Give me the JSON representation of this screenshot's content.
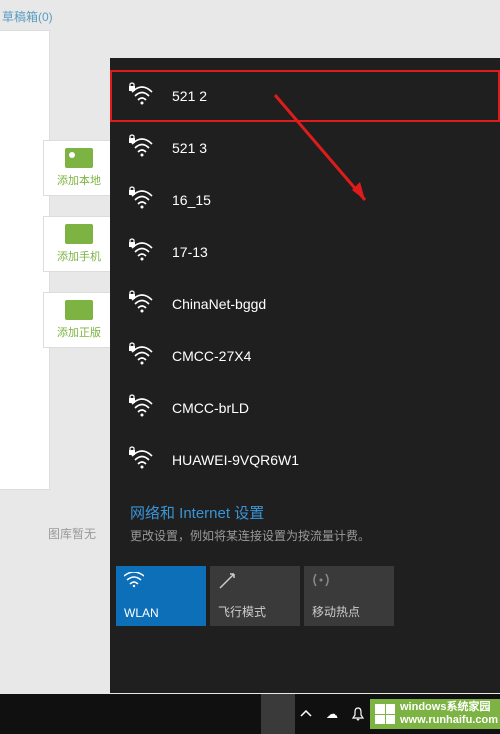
{
  "top": {
    "draft_label": "草稿箱(0)"
  },
  "side": {
    "add_local": "添加本地",
    "add_phone": "添加手机",
    "add_genuine": "添加正版"
  },
  "gallery": {
    "empty": "图库暂无"
  },
  "wifi": {
    "networks": [
      {
        "ssid": "521 2",
        "secured": true,
        "highlighted": true
      },
      {
        "ssid": "521 3",
        "secured": true
      },
      {
        "ssid": "16_15",
        "secured": true
      },
      {
        "ssid": "17-13",
        "secured": true
      },
      {
        "ssid": "ChinaNet-bggd",
        "secured": true
      },
      {
        "ssid": "CMCC-27X4",
        "secured": true
      },
      {
        "ssid": "CMCC-brLD",
        "secured": true
      },
      {
        "ssid": "HUAWEI-9VQR6W1",
        "secured": true
      }
    ],
    "settings_title": "网络和 Internet 设置",
    "settings_sub": "更改设置，例如将某连接设置为按流量计费。",
    "tiles": {
      "wlan": "WLAN",
      "airplane": "飞行模式",
      "hotspot": "移动热点"
    }
  },
  "watermark": {
    "line1": "windows系统家园",
    "line2": "www.runhaifu.com"
  }
}
